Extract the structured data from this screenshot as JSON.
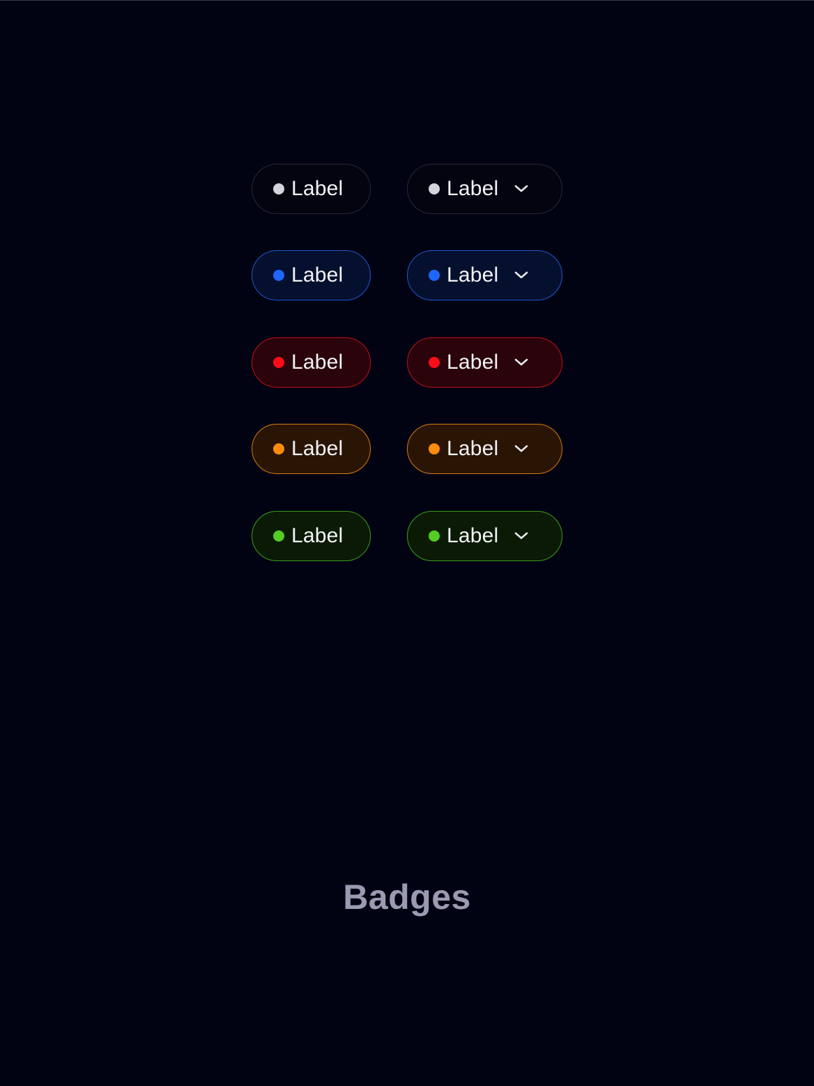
{
  "page": {
    "title": "Badges",
    "background": "#020312"
  },
  "badges": [
    {
      "tone": "neutral",
      "label": "Label",
      "dropdown_label": "Label",
      "dot_color": "#d4d4dc",
      "border_color": "#262a36"
    },
    {
      "tone": "blue",
      "label": "Label",
      "dropdown_label": "Label",
      "dot_color": "#1f66ff",
      "border_color": "#1d57d6"
    },
    {
      "tone": "red",
      "label": "Label",
      "dropdown_label": "Label",
      "dot_color": "#ff0c18",
      "border_color": "#c40f1c"
    },
    {
      "tone": "orange",
      "label": "Label",
      "dropdown_label": "Label",
      "dot_color": "#ff8c0c",
      "border_color": "#d77b12"
    },
    {
      "tone": "green",
      "label": "Label",
      "dropdown_label": "Label",
      "dot_color": "#53cc25",
      "border_color": "#3c9d1d"
    }
  ],
  "icons": {
    "dropdown": "chevron-down-icon",
    "status": "status-dot-icon"
  }
}
